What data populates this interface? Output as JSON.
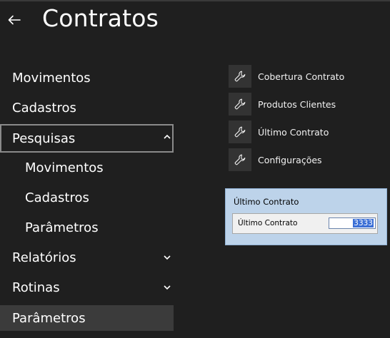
{
  "header": {
    "title": "Contratos"
  },
  "nav": {
    "movimentos": "Movimentos",
    "cadastros": "Cadastros",
    "pesquisas": "Pesquisas",
    "pesquisas_sub": {
      "movimentos": "Movimentos",
      "cadastros": "Cadastros",
      "parametros": "Parâmetros"
    },
    "relatorios": "Relatórios",
    "rotinas": "Rotinas",
    "parametros": "Parâmetros"
  },
  "actions": [
    {
      "label": "Cobertura Contrato",
      "icon": "wrench-icon"
    },
    {
      "label": "Produtos Clientes",
      "icon": "wrench-icon"
    },
    {
      "label": "Último Contrato",
      "icon": "wrench-icon"
    },
    {
      "label": "Configurações",
      "icon": "wrench-icon"
    }
  ],
  "dialog": {
    "title": "Último Contrato",
    "field_label": "Último Contrato",
    "field_value": "3333"
  },
  "colors": {
    "background": "#1f1f1f",
    "selected_item": "#3b3b3b",
    "dialog_bg": "#bdd3ea",
    "selection": "#3b6fd6"
  }
}
